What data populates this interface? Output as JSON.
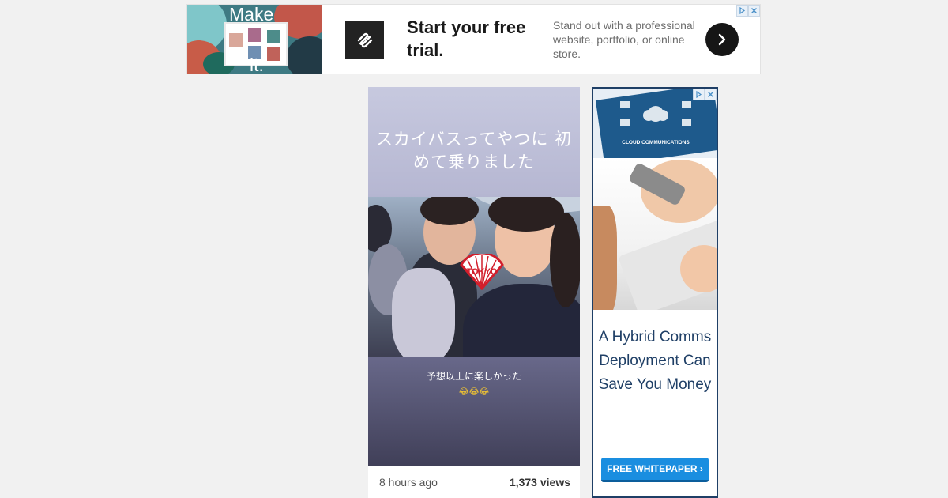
{
  "banner_ad": {
    "art_text_top": "Make",
    "art_text_bottom": "it.",
    "logo_icon": "squarespace-logo-icon",
    "headline": "Start your free trial.",
    "subtext": "Stand out with a professional website, portfolio, or online store.",
    "arrow_icon": "chevron-right-icon",
    "adchoices_icon": "adchoices-icon",
    "close_icon": "close-icon"
  },
  "video_card": {
    "top_caption": "スカイバスってやつに 初めて乗りました",
    "bottom_caption": "予想以上に楽しかった",
    "emoji": "😂😂😂",
    "fan_text": "TOKYO",
    "time_ago": "8 hours ago",
    "views": "1,373 views"
  },
  "sky_ad": {
    "book_title": "CLOUD COMMUNICATIONS",
    "headline": "A Hybrid Comms Deployment Can Save You Money",
    "cta": "FREE WHITEPAPER ›",
    "adchoices_icon": "adchoices-icon",
    "close_icon": "close-icon"
  },
  "colors": {
    "page_bg": "#f1f1f1",
    "sky_border": "#1f3f66",
    "cta_blue": "#1a8ee0"
  }
}
